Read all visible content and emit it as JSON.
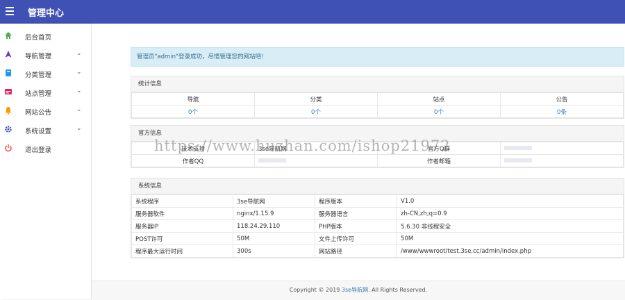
{
  "app": {
    "title": "管理中心"
  },
  "sidebar": {
    "items": [
      {
        "label": "后台首页",
        "icon": "home-icon",
        "color": "#4caf50",
        "chevron": false
      },
      {
        "label": "导航管理",
        "icon": "navigation-icon",
        "color": "#673ab7",
        "chevron": true
      },
      {
        "label": "分类管理",
        "icon": "book-icon",
        "color": "#2196f3",
        "chevron": true
      },
      {
        "label": "站点管理",
        "icon": "site-icon",
        "color": "#e91e63",
        "chevron": true
      },
      {
        "label": "网站公告",
        "icon": "bell-icon",
        "color": "#ff9800",
        "chevron": true
      },
      {
        "label": "系统设置",
        "icon": "gear-icon",
        "color": "#3f51b5",
        "chevron": true
      },
      {
        "label": "退出登录",
        "icon": "power-icon",
        "color": "#f44336",
        "chevron": false
      }
    ]
  },
  "alert": {
    "text": "管理员\"admin\"登录成功，尽情管理您的网站吧！"
  },
  "stats": {
    "title": "统计信息",
    "headers": [
      "导航",
      "分类",
      "站点",
      "公告"
    ],
    "values": [
      "0个",
      "0个",
      "0个",
      "0条"
    ]
  },
  "official": {
    "title": "官方信息",
    "rows": [
      [
        "技术支持",
        "3se导航网",
        "官方Q群",
        ""
      ],
      [
        "作者QQ",
        "",
        "作者邮箱",
        ""
      ]
    ]
  },
  "system": {
    "title": "系统信息",
    "rows": [
      [
        "系统程序",
        "3se导航网",
        "程序版本",
        "V1.0"
      ],
      [
        "服务器软件",
        "nginx/1.15.9",
        "服务器语言",
        "zh-CN,zh;q=0.9"
      ],
      [
        "服务器IP",
        "118.24.29.110",
        "PHP版本",
        "5.6.30 非线程安全"
      ],
      [
        "POST许可",
        "50M",
        "文件上传许可",
        "50M"
      ],
      [
        "程序最大运行时间",
        "300s",
        "网站路径",
        "/www/wwwroot/test.3se.cc/admin/index.php"
      ]
    ]
  },
  "watermark": "https://www.huzhan.com/ishop21972",
  "footer": {
    "prefix": "Copyright © 2019 ",
    "link": "3se导航网",
    "suffix": ". All Rights Reserved."
  },
  "colors": {
    "topbar": "#3f51b5",
    "link": "#337ab7",
    "alert_bg": "#d9edf7"
  }
}
